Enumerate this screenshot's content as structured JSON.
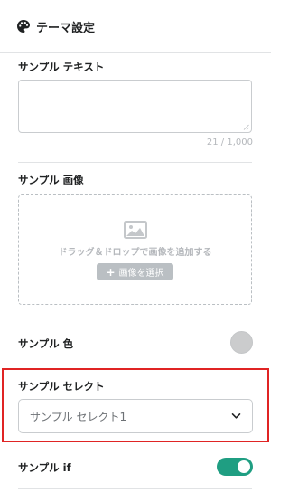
{
  "header": {
    "title": "テーマ設定",
    "icon": "palette-icon"
  },
  "text_section": {
    "label": "サンプル テキスト",
    "value": "",
    "counter": "21 / 1,000"
  },
  "image_section": {
    "label": "サンプル 画像",
    "drop_text": "ドラッグ＆ドロップで画像を追加する",
    "add_button_label": "画像を選択",
    "icon": "image-icon"
  },
  "color_section": {
    "label": "サンプル 色",
    "swatch_color": "#cbcccd"
  },
  "select_section": {
    "label": "サンプル セレクト",
    "selected_value": "サンプル セレクト1"
  },
  "toggle_section": {
    "label": "サンプル if",
    "enabled": true,
    "accent_color": "#1f9e82"
  }
}
